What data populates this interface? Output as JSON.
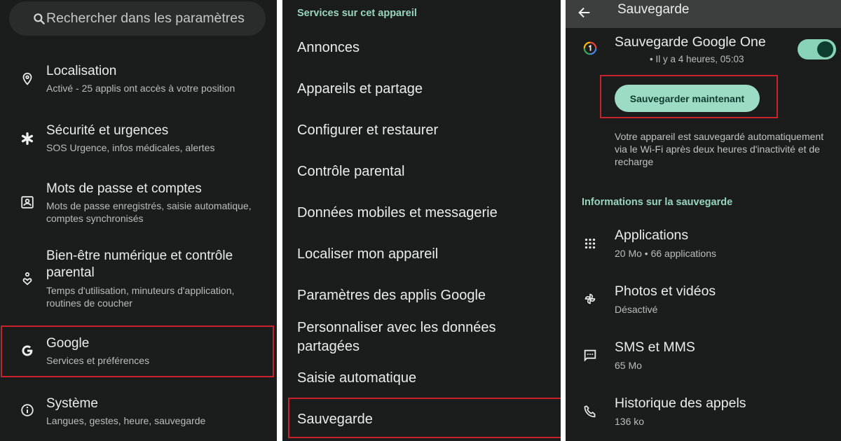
{
  "colors": {
    "background": "#1b1c1c",
    "accent_green": "#98d6bf",
    "button_green": "#9cdcc5",
    "highlight_red": "#c8232c",
    "appbar": "#3d3f3e"
  },
  "panel1": {
    "search": {
      "placeholder": "Rechercher dans les paramètres",
      "icon": "search-icon"
    },
    "items": [
      {
        "title": "Localisation",
        "subtitle": "Activé - 25 applis ont accès à votre position",
        "icon": "location-pin-icon"
      },
      {
        "title": "Sécurité et urgences",
        "subtitle": "SOS Urgence, infos médicales, alertes",
        "icon": "asterisk-icon"
      },
      {
        "title": "Mots de passe et comptes",
        "subtitle": "Mots de passe enregistrés, saisie automatique, comptes synchronisés",
        "icon": "account-box-icon"
      },
      {
        "title": "Bien-être numérique et contrôle parental",
        "subtitle": "Temps d'utilisation, minuteurs d'application, routines de coucher",
        "icon": "wellbeing-icon"
      },
      {
        "title": "Google",
        "subtitle": "Services et préférences",
        "icon": "google-g-icon",
        "highlighted": true
      },
      {
        "title": "Système",
        "subtitle": "Langues, gestes, heure, sauvegarde",
        "icon": "info-icon"
      }
    ]
  },
  "panel2": {
    "section_header": "Services sur cet appareil",
    "items": [
      "Annonces",
      "Appareils et partage",
      "Configurer et restaurer",
      "Contrôle parental",
      "Données mobiles et messagerie",
      "Localiser mon appareil",
      "Paramètres des applis Google",
      "Personnaliser avec les données partagées",
      "Saisie automatique",
      "Sauvegarde"
    ],
    "highlighted_item": "Sauvegarde"
  },
  "panel3": {
    "appbar": {
      "title": "Sauvegarde",
      "back_icon": "arrow-back-icon"
    },
    "google_one": {
      "title": "Sauvegarde Google One",
      "status": "• Il y a 4 heures, 05:03",
      "toggle_on": true
    },
    "backup_now_label": "Sauvegarder maintenant",
    "description": "Votre appareil est sauvegardé automatiquement via le Wi-Fi après deux heures d'inactivité et de recharge",
    "section_header": "Informations sur la sauvegarde",
    "items": [
      {
        "title": "Applications",
        "subtitle": "20 Mo • 66 applications",
        "icon": "apps-grid-icon"
      },
      {
        "title": "Photos et vidéos",
        "subtitle": "Désactivé",
        "icon": "pinwheel-icon"
      },
      {
        "title": "SMS et MMS",
        "subtitle": "65 Mo",
        "icon": "message-icon"
      },
      {
        "title": "Historique des appels",
        "subtitle": "136 ko",
        "icon": "phone-icon"
      }
    ]
  }
}
